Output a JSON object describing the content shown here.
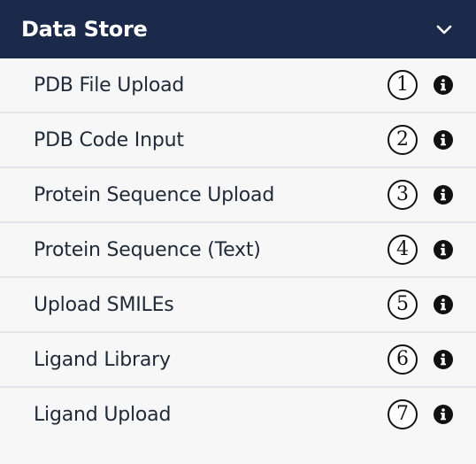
{
  "header": {
    "title": "Data Store",
    "toggle_icon": "chevron-down-icon"
  },
  "items": [
    {
      "label": "PDB File Upload",
      "number": "1"
    },
    {
      "label": "PDB Code Input",
      "number": "2"
    },
    {
      "label": "Protein Sequence Upload",
      "number": "3"
    },
    {
      "label": "Protein Sequence (Text)",
      "number": "4"
    },
    {
      "label": "Upload SMILEs",
      "number": "5"
    },
    {
      "label": "Ligand Library",
      "number": "6"
    },
    {
      "label": "Ligand Upload",
      "number": "7"
    }
  ],
  "colors": {
    "header_bg": "#1b2a4a",
    "row_bg": "#f7f7f8",
    "divider": "#e3e5ea",
    "text": "#1f2937"
  }
}
